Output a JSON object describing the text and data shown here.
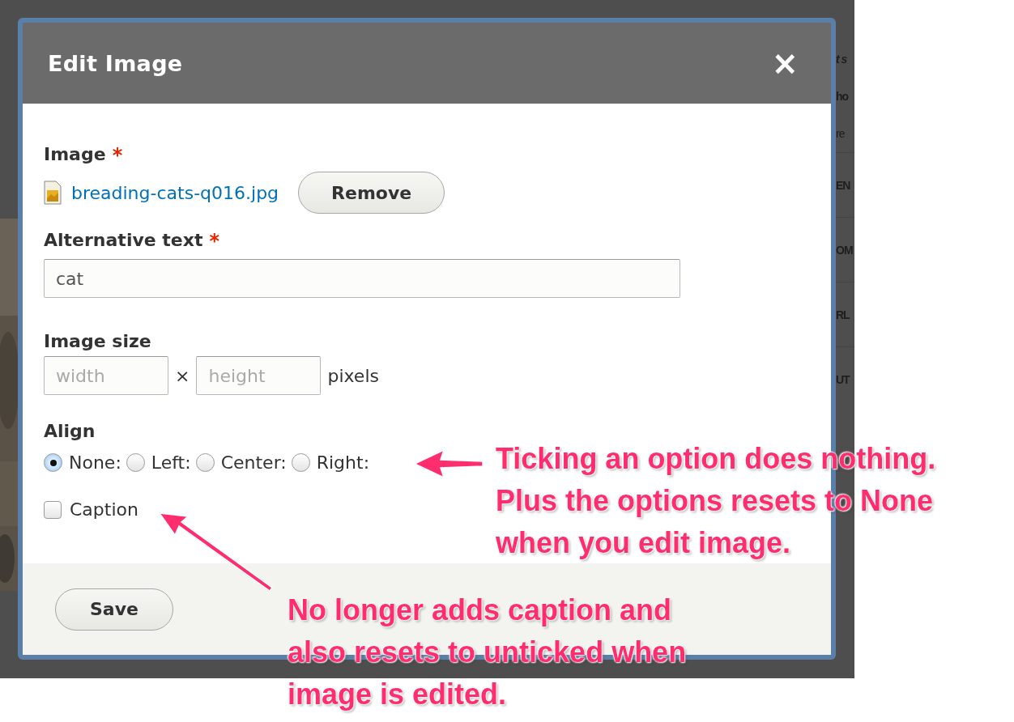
{
  "background": {
    "fragments": [
      {
        "text": "t s",
        "kind": "italic"
      },
      {
        "text": "ho",
        "kind": "bold"
      },
      {
        "text": "re",
        "kind": "plain"
      },
      {
        "text": "EN",
        "kind": "row"
      },
      {
        "text": "OM",
        "kind": "row"
      },
      {
        "text": "RL",
        "kind": "row"
      },
      {
        "text": "UT",
        "kind": "row"
      }
    ]
  },
  "dialog": {
    "title": "Edit Image",
    "close": "×",
    "image": {
      "label": "Image",
      "required_mark": "*",
      "file": "breading-cats-q016.jpg",
      "remove": "Remove"
    },
    "alt": {
      "label": "Alternative text",
      "required_mark": "*",
      "value": "cat"
    },
    "size": {
      "label": "Image size",
      "width_placeholder": "width",
      "times": "×",
      "height_placeholder": "height",
      "unit": "pixels"
    },
    "align": {
      "label": "Align",
      "options": [
        {
          "label": "None:",
          "selected": true
        },
        {
          "label": "Left:",
          "selected": false
        },
        {
          "label": "Center:",
          "selected": false
        },
        {
          "label": "Right:",
          "selected": false
        }
      ]
    },
    "caption": {
      "label": "Caption",
      "checked": false
    },
    "save": "Save"
  },
  "annotations": [
    {
      "text": "Ticking an option does nothing. Plus the options resets to None when you edit image."
    },
    {
      "text": "No longer adds caption and also resets to unticked when image is edited."
    }
  ]
}
